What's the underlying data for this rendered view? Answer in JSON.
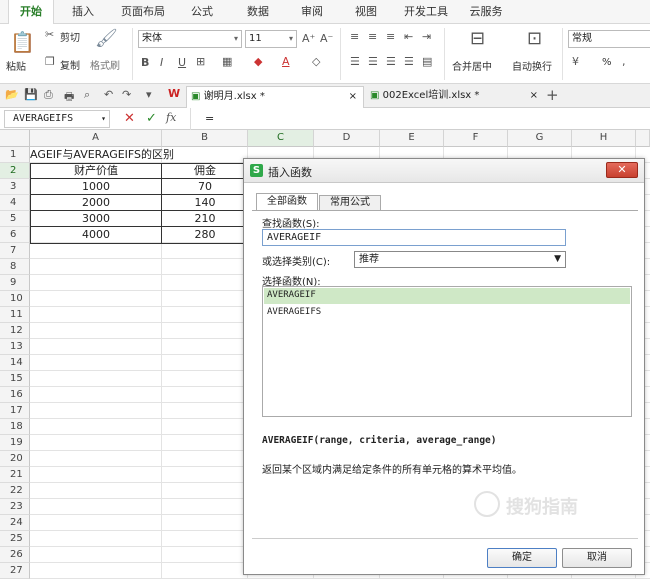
{
  "ribbon_tabs": [
    "开始",
    "插入",
    "页面布局",
    "公式",
    "数据",
    "审阅",
    "视图",
    "开发工具",
    "云服务"
  ],
  "ribbon": {
    "paste": "粘贴",
    "cut": "剪切",
    "copy": "复制",
    "format_painter": "格式刷",
    "font_name": "宋体",
    "font_size": "11",
    "merge_center": "合并居中",
    "wrap_text": "自动换行",
    "number_format": "常规",
    "percent": "%"
  },
  "doc_tabs": [
    {
      "name": "谢明月.xlsx *",
      "active": true
    },
    {
      "name": "002Excel培训.xlsx *",
      "active": false
    }
  ],
  "formula_bar": {
    "name_box": "AVERAGEIFS",
    "fx": "fx",
    "content": "="
  },
  "columns": [
    "A",
    "B",
    "C",
    "D",
    "E",
    "F",
    "G",
    "H"
  ],
  "rows": [
    "1",
    "2",
    "3",
    "4",
    "5",
    "6",
    "7",
    "8",
    "9",
    "10",
    "11",
    "12",
    "13",
    "14",
    "15",
    "16",
    "17",
    "18",
    "19",
    "20",
    "21",
    "22",
    "23",
    "24",
    "25",
    "26",
    "27"
  ],
  "sheet": {
    "a1": "AGEIF与AVERAGEIFS的区别",
    "header": [
      "财产价值",
      "佣金"
    ],
    "data": [
      [
        "1000",
        "70"
      ],
      [
        "2000",
        "140"
      ],
      [
        "3000",
        "210"
      ],
      [
        "4000",
        "280"
      ]
    ]
  },
  "dialog": {
    "title": "插入函数",
    "tab_all": "全部函数",
    "tab_common": "常用公式",
    "search_label": "查找函数(S):",
    "search_value": "AVERAGEIF",
    "category_label": "或选择类别(C):",
    "category_value": "推荐",
    "select_label": "选择函数(N):",
    "functions": [
      "AVERAGEIF",
      "AVERAGEIFS"
    ],
    "signature": "AVERAGEIF(range, criteria, average_range)",
    "description": "返回某个区域内满足给定条件的所有单元格的算术平均值。",
    "ok": "确定",
    "cancel": "取消",
    "watermark": "搜狗指南"
  }
}
